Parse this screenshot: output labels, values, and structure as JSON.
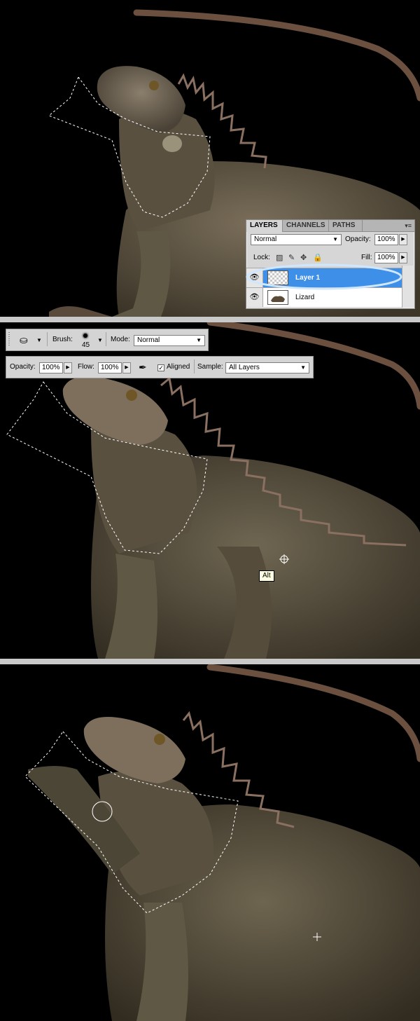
{
  "layers_panel": {
    "tabs": [
      {
        "label": "LAYERS",
        "active": true
      },
      {
        "label": "CHANNELS",
        "active": false
      },
      {
        "label": "PATHS",
        "active": false
      }
    ],
    "menu_glyph": "▾≡",
    "blend_mode": "Normal",
    "opacity_label": "Opacity:",
    "opacity_value": "100%",
    "lock_label": "Lock:",
    "fill_label": "Fill:",
    "fill_value": "100%",
    "layers": [
      {
        "name": "Layer 1",
        "selected": true,
        "thumbnail": "transparent-checker"
      },
      {
        "name": "Lizard",
        "selected": false,
        "thumbnail": "lizard-photo"
      }
    ]
  },
  "clone_options_bar": {
    "row1": {
      "brush_label": "Brush:",
      "brush_size": "45",
      "mode_label": "Mode:",
      "mode_value": "Normal"
    },
    "row2": {
      "opacity_label": "Opacity:",
      "opacity_value": "100%",
      "flow_label": "Flow:",
      "flow_value": "100%",
      "aligned_label": "Aligned",
      "aligned_checked": true,
      "sample_label": "Sample:",
      "sample_value": "All Layers"
    }
  },
  "tooltip": {
    "text": "Alt"
  },
  "icons": {
    "eye": "eye-icon",
    "clone_stamp": "clone-stamp-icon",
    "airbrush": "airbrush-icon"
  },
  "colors": {
    "selection_highlight": "#3d8fe8",
    "tooltip_bg": "#ffffe1",
    "background": "#000000"
  }
}
